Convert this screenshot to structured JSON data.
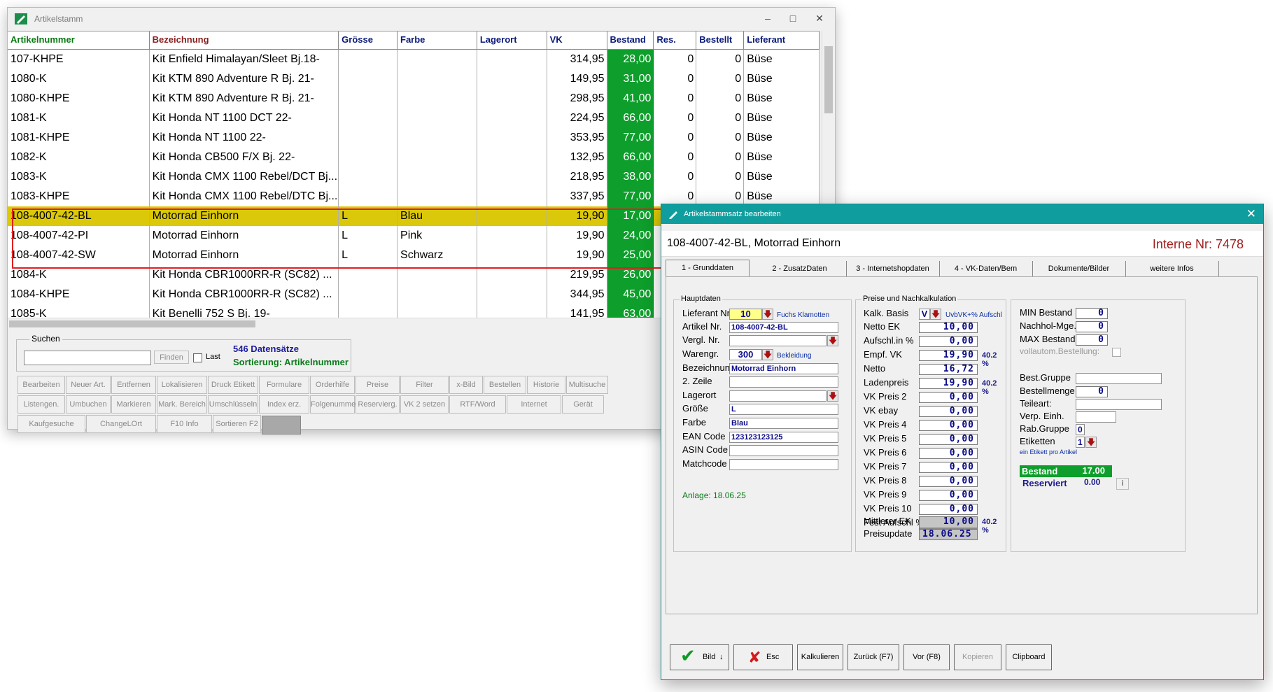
{
  "window_main": {
    "title": "Artikelstamm",
    "columns": [
      "Artikelnummer",
      "Bezeichnung",
      "Grösse",
      "Farbe",
      "Lagerort",
      "VK",
      "Bestand",
      "Res.",
      "Bestellt",
      "Lieferant"
    ],
    "column_colors": [
      "#0a7a14",
      "#8a1f1f",
      "#0a1a7a",
      "#0a1a7a",
      "#0a1a7a",
      "#0a1a7a",
      "#0a1a7a",
      "#0a1a7a",
      "#0a1a7a",
      "#0a1a7a"
    ],
    "rows": [
      {
        "art": "107-KHPE",
        "bez": "Kit Enfield Himalayan/Sleet Bj.18-",
        "gr": "",
        "farbe": "",
        "lager": "",
        "vk": "314,95",
        "bestand": "28,00",
        "res": "0",
        "bestellt": "0",
        "lief": "Büse"
      },
      {
        "art": "1080-K",
        "bez": "Kit KTM 890 Adventure R Bj. 21-",
        "gr": "",
        "farbe": "",
        "lager": "",
        "vk": "149,95",
        "bestand": "31,00",
        "res": "0",
        "bestellt": "0",
        "lief": "Büse"
      },
      {
        "art": "1080-KHPE",
        "bez": "Kit KTM 890 Adventure R Bj. 21-",
        "gr": "",
        "farbe": "",
        "lager": "",
        "vk": "298,95",
        "bestand": "41,00",
        "res": "0",
        "bestellt": "0",
        "lief": "Büse"
      },
      {
        "art": "1081-K",
        "bez": "Kit Honda NT 1100 DCT 22-",
        "gr": "",
        "farbe": "",
        "lager": "",
        "vk": "224,95",
        "bestand": "66,00",
        "res": "0",
        "bestellt": "0",
        "lief": "Büse"
      },
      {
        "art": "1081-KHPE",
        "bez": "Kit Honda NT 1100 22-",
        "gr": "",
        "farbe": "",
        "lager": "",
        "vk": "353,95",
        "bestand": "77,00",
        "res": "0",
        "bestellt": "0",
        "lief": "Büse"
      },
      {
        "art": "1082-K",
        "bez": "Kit Honda CB500 F/X Bj. 22-",
        "gr": "",
        "farbe": "",
        "lager": "",
        "vk": "132,95",
        "bestand": "66,00",
        "res": "0",
        "bestellt": "0",
        "lief": "Büse"
      },
      {
        "art": "1083-K",
        "bez": "Kit Honda CMX 1100 Rebel/DCT Bj...",
        "gr": "",
        "farbe": "",
        "lager": "",
        "vk": "218,95",
        "bestand": "38,00",
        "res": "0",
        "bestellt": "0",
        "lief": "Büse"
      },
      {
        "art": "1083-KHPE",
        "bez": "Kit Honda CMX 1100 Rebel/DTC Bj...",
        "gr": "",
        "farbe": "",
        "lager": "",
        "vk": "337,95",
        "bestand": "77,00",
        "res": "0",
        "bestellt": "0",
        "lief": "Büse"
      },
      {
        "art": "108-4007-42-BL",
        "bez": "Motorrad Einhorn",
        "gr": "L",
        "farbe": "Blau",
        "lager": "",
        "vk": "19,90",
        "bestand": "17,00",
        "res": "",
        "bestellt": "",
        "lief": ""
      },
      {
        "art": "108-4007-42-PI",
        "bez": "Motorrad Einhorn",
        "gr": "L",
        "farbe": "Pink",
        "lager": "",
        "vk": "19,90",
        "bestand": "24,00",
        "res": "",
        "bestellt": "",
        "lief": ""
      },
      {
        "art": "108-4007-42-SW",
        "bez": "Motorrad Einhorn",
        "gr": "L",
        "farbe": "Schwarz",
        "lager": "",
        "vk": "19,90",
        "bestand": "25,00",
        "res": "",
        "bestellt": "",
        "lief": ""
      },
      {
        "art": "1084-K",
        "bez": "Kit Honda CBR1000RR-R (SC82) ...",
        "gr": "",
        "farbe": "",
        "lager": "",
        "vk": "219,95",
        "bestand": "26,00",
        "res": "",
        "bestellt": "",
        "lief": ""
      },
      {
        "art": "1084-KHPE",
        "bez": "Kit Honda CBR1000RR-R (SC82) ...",
        "gr": "",
        "farbe": "",
        "lager": "",
        "vk": "344,95",
        "bestand": "45,00",
        "res": "",
        "bestellt": "",
        "lief": ""
      },
      {
        "art": "1085-K",
        "bez": "Kit Benelli 752 S Bj. 19-",
        "gr": "",
        "farbe": "",
        "lager": "",
        "vk": "141,95",
        "bestand": "63,00",
        "res": "",
        "bestellt": "",
        "lief": ""
      }
    ],
    "selected_row": 8,
    "search": {
      "label": "Suchen",
      "find": "Finden",
      "last": "Last",
      "value": ""
    },
    "record_count": "546 Datensätze",
    "sort_info": "Sortierung: Artikelnummer",
    "toolbar1": [
      "Bearbeiten",
      "Neuer Art.",
      "Entfernen",
      "Lokalisieren",
      "Druck Etikett",
      "Formulare",
      "Orderhilfe",
      "Preise",
      "Filter",
      "x-Bild",
      "Bestellen",
      "Historie",
      "Multisuche"
    ],
    "toolbar2": [
      "Listengen.",
      "Umbuchen",
      "Markieren",
      "Mark. Bereich",
      "Umschlüsseln",
      "Index erz.",
      "Folgenummern",
      "Reservierg.",
      "VK 2 setzen",
      "RTF/Word",
      "Internet",
      "Gerät"
    ],
    "toolbar3": [
      "Kaufgesuche",
      "ChangeLOrt",
      "F10 Info",
      "Sortieren F2"
    ]
  },
  "dialog": {
    "title": "Artikelstammsatz bearbeiten",
    "record_title": "108-4007-42-BL, Motorrad Einhorn",
    "interne_nr": "Interne Nr: 7478",
    "tabs": [
      "1 - Grunddaten",
      "2 - ZusatzDaten",
      "3 - Internetshopdaten",
      "4 - VK-Daten/Bem",
      "Dokumente/Bilder",
      "weitere Infos"
    ],
    "hauptdaten": {
      "group": "Hauptdaten",
      "lieferant_label": "Lieferant Nr",
      "lieferant_value": "10",
      "lieferant_name": "Fuchs Klamotten",
      "artikel_label": "Artikel Nr.",
      "artikel_value": "108-4007-42-BL",
      "vergl_label": "Vergl. Nr.",
      "vergl_value": "",
      "warengr_label": "Warengr.",
      "warengr_value": "300",
      "warengr_name": "Bekleidung",
      "bez_label": "Bezeichnung",
      "bez_value": "Motorrad Einhorn",
      "zeile2_label": "2. Zeile",
      "zeile2_value": "",
      "lagerort_label": "Lagerort",
      "lagerort_value": "",
      "groesse_label": "Größe",
      "groesse_value": "L",
      "farbe_label": "Farbe",
      "farbe_value": "Blau",
      "ean_label": "EAN Code",
      "ean_value": "123123123125",
      "asin_label": "ASIN Code",
      "asin_value": "",
      "match_label": "Matchcode",
      "match_value": "",
      "anlage": "Anlage: 18.06.25"
    },
    "preise": {
      "group": "Preise und Nachkalkulation",
      "kalk_label": "Kalk. Basis",
      "kalk_value": "V",
      "kalk_note": "UvbVK+% Aufschl",
      "fields": [
        {
          "label": "Netto EK",
          "value": "10,00",
          "pct": ""
        },
        {
          "label": "Aufschl.in %",
          "value": "0,00",
          "pct": ""
        },
        {
          "label": "Empf. VK",
          "value": "19,90",
          "pct": "40.2 %"
        },
        {
          "label": "Netto",
          "value": "16,72",
          "pct": ""
        },
        {
          "label": "Ladenpreis",
          "value": "19,90",
          "pct": "40.2 %"
        },
        {
          "label": "VK Preis 2",
          "value": "0,00",
          "pct": ""
        },
        {
          "label": "VK ebay",
          "value": "0,00",
          "pct": ""
        },
        {
          "label": "VK Preis 4",
          "value": "0,00",
          "pct": ""
        },
        {
          "label": "VK Preis 5",
          "value": "0,00",
          "pct": ""
        },
        {
          "label": "VK Preis 6",
          "value": "0,00",
          "pct": ""
        },
        {
          "label": "VK Preis 7",
          "value": "0,00",
          "pct": ""
        },
        {
          "label": "VK Preis 8",
          "value": "0,00",
          "pct": ""
        },
        {
          "label": "VK Preis 9",
          "value": "0,00",
          "pct": ""
        },
        {
          "label": "VK Preis 10",
          "value": "0,00",
          "pct": ""
        },
        {
          "label": "Fest Aufschl %",
          "value": "0,00",
          "pct": ""
        }
      ],
      "mittlerer_label": "Mittlerer EK",
      "mittlerer_value": "10,00",
      "mittlerer_pct": "40.2 %",
      "preisupdate_label": "Preisupdate",
      "preisupdate_value": "18.06.25"
    },
    "bestand": {
      "min_label": "MIN Bestand",
      "min_value": "0",
      "nachhol_label": "Nachhol-Mge.",
      "nachhol_value": "0",
      "max_label": "MAX Bestand",
      "max_value": "0",
      "vollautom_label": "vollautom.Bestellung:",
      "bestgruppe_label": "Best.Gruppe",
      "bestgruppe_value": "",
      "bestellmenge_label": "Bestellmenge",
      "bestellmenge_value": "0",
      "teileart_label": "Teileart:",
      "teileart_value": "",
      "verp_label": "Verp. Einh.",
      "verp_value": "",
      "rab_label": "Rab.Gruppe",
      "rab_value": "0",
      "etiketten_label": "Etiketten",
      "etiketten_value": "1",
      "etiketten_note": "ein Etikett pro Artikel",
      "bestand_label": "Bestand",
      "bestand_value": "17.00",
      "reserviert_label": "Reserviert",
      "reserviert_value": "0.00",
      "info_btn": "i"
    },
    "buttons": [
      "Bild",
      "Esc",
      "Kalkulieren",
      "Zurück (F7)",
      "Vor (F8)",
      "Kopieren",
      "Clipboard"
    ]
  }
}
